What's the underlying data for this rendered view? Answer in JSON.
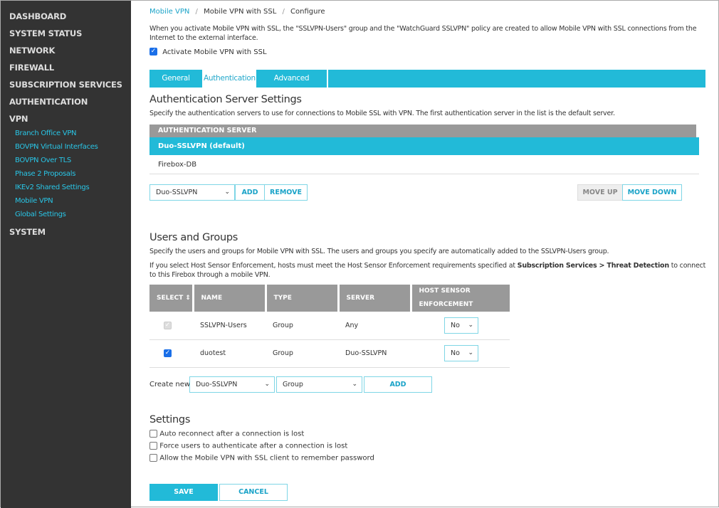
{
  "sidebar": {
    "items": [
      "DASHBOARD",
      "SYSTEM STATUS",
      "NETWORK",
      "FIREWALL",
      "SUBSCRIPTION SERVICES",
      "AUTHENTICATION",
      "VPN"
    ],
    "vpn_sub": [
      "Branch Office VPN",
      "BOVPN Virtual Interfaces",
      "BOVPN Over TLS",
      "Phase 2 Proposals",
      "IKEv2 Shared Settings",
      "Mobile VPN",
      "Global Settings"
    ],
    "system": "SYSTEM"
  },
  "breadcrumb": {
    "a": "Mobile VPN",
    "b": "Mobile VPN with SSL",
    "c": "Configure",
    "sep": "/"
  },
  "intro": "When you activate Mobile VPN with SSL, the \"SSLVPN-Users\" group and the \"WatchGuard SSLVPN\" policy are created to allow Mobile VPN with SSL connections from the Internet to the external interface.",
  "activate_label": "Activate Mobile VPN with SSL",
  "tabs": [
    "General",
    "Authentication",
    "Advanced"
  ],
  "auth": {
    "title": "Authentication Server Settings",
    "desc": "Specify the authentication servers to use for connections to Mobile SSL with VPN. The first authentication server in the list is the default server.",
    "header": "AUTHENTICATION SERVER",
    "rows": [
      "Duo-SSLVPN (default)",
      "Firebox-DB"
    ],
    "select": "Duo-SSLVPN",
    "add": "ADD",
    "remove": "REMOVE",
    "move_up": "MOVE UP",
    "move_down": "MOVE DOWN"
  },
  "users": {
    "title": "Users and Groups",
    "desc": "Specify the users and groups for Mobile VPN with SSL. The users and groups you specify are automatically added to the SSLVPN-Users group.",
    "note_a": "If you select Host Sensor Enforcement, hosts must meet the Host Sensor Enforcement requirements specified at ",
    "note_b": "Subscription Services > Threat Detection",
    "note_c": " to connect to this Firebox through a mobile VPN.",
    "headers": [
      "SELECT",
      "NAME",
      "TYPE",
      "SERVER",
      "HOST SENSOR ENFORCEMENT"
    ],
    "rows": [
      {
        "name": "SSLVPN-Users",
        "type": "Group",
        "server": "Any",
        "hse": "No"
      },
      {
        "name": "duotest",
        "type": "Group",
        "server": "Duo-SSLVPN",
        "hse": "No"
      }
    ],
    "create_label": "Create new:",
    "create_server": "Duo-SSLVPN",
    "create_type": "Group",
    "add": "ADD"
  },
  "settings": {
    "title": "Settings",
    "options": [
      "Auto reconnect after a connection is lost",
      "Force users to authenticate after a connection is lost",
      "Allow the Mobile VPN with SSL client to remember password"
    ]
  },
  "save": "SAVE",
  "cancel": "CANCEL"
}
